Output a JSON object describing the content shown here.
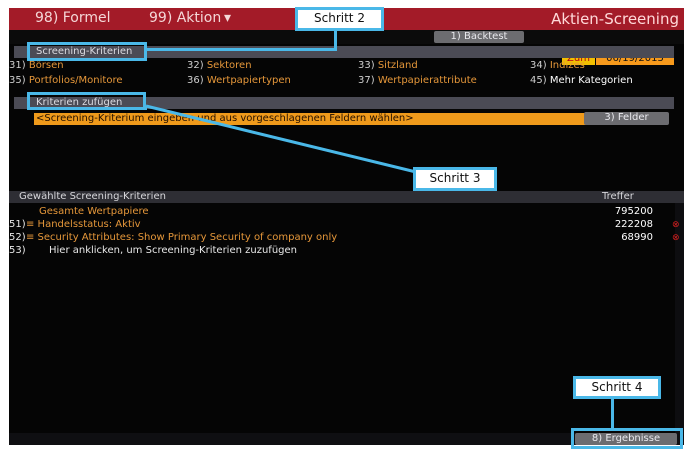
{
  "title_bar": {
    "formel": "98) Formel",
    "aktion": "99) Aktion",
    "aktion_caret": "▾",
    "app_title": "Aktien-Screening"
  },
  "toolbar": {
    "backtest": "1) Backtest",
    "zum": "Zum",
    "date": "06/19/2015"
  },
  "screening_header": "Screening-Kriterien",
  "categories_row1": [
    {
      "num": "31)",
      "label": "Börsen"
    },
    {
      "num": "32)",
      "label": "Sektoren"
    },
    {
      "num": "33)",
      "label": "Sitzland"
    },
    {
      "num": "34)",
      "label": "Indizes"
    }
  ],
  "categories_row2": [
    {
      "num": "35)",
      "label": "Portfolios/Monitore"
    },
    {
      "num": "36)",
      "label": "Wertpapiertypen"
    },
    {
      "num": "37)",
      "label": "Wertpapierattribute"
    },
    {
      "num": "45)",
      "label": "Mehr Kategorien"
    }
  ],
  "add_criteria": {
    "header": "Kriterien zufügen",
    "input_text": "<Screening-Kriterium eingeben und aus vorgeschlagenen Feldern wählen>",
    "fields_button": "3) Felder"
  },
  "selected": {
    "header": "Gewählte Screening-Kriterien",
    "hits_header": "Treffer",
    "rows": [
      {
        "num": "",
        "label": "Gesamte Wertpapiere",
        "count": "795200"
      },
      {
        "num": "51)",
        "label": "≡  Handelsstatus: Aktiv",
        "count": "222208"
      },
      {
        "num": "52)",
        "label": "≡  Security Attributes: Show Primary Security of company only",
        "count": "68990"
      },
      {
        "num": "53)",
        "label": "Hier anklicken, um Screening-Kriterien zuzufügen",
        "count": ""
      }
    ]
  },
  "results_button": "8) Ergebnisse",
  "callouts": {
    "schritt2": "Schritt 2",
    "schritt3": "Schritt 3",
    "schritt4": "Schritt 4"
  },
  "colors": {
    "title_bar": "#a31b28",
    "accent_orange": "#ef9a1b",
    "callout_blue": "#4ab8e8"
  }
}
